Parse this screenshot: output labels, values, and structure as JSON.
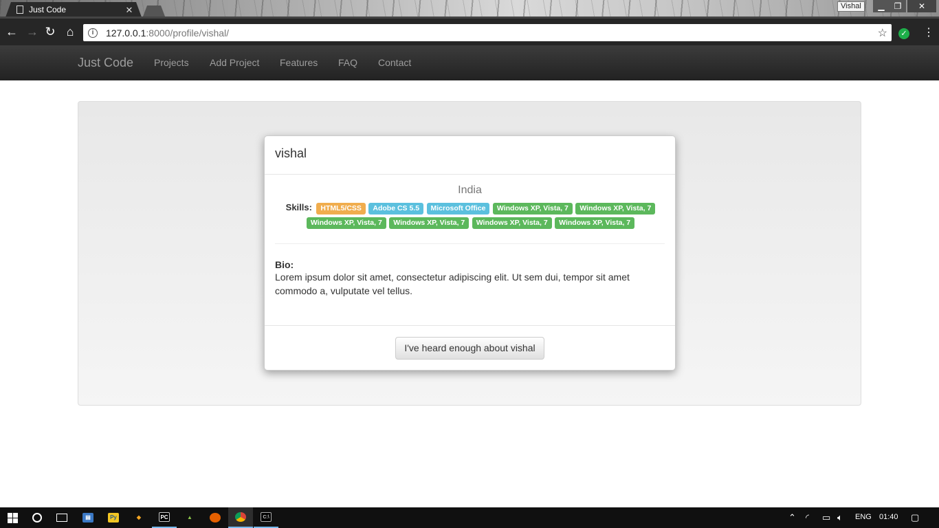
{
  "browser": {
    "tab_title": "Just Code",
    "profile_name": "Vishal",
    "url_host": "127.0.0.1",
    "url_path": ":8000/profile/vishal/"
  },
  "navbar": {
    "brand": "Just Code",
    "links": [
      "Projects",
      "Add Project",
      "Features",
      "FAQ",
      "Contact"
    ]
  },
  "profile": {
    "name": "vishal",
    "country": "India",
    "skills_label": "Skills:",
    "skills": [
      {
        "text": "HTML5/CSS",
        "style": "warning"
      },
      {
        "text": "Adobe CS 5.5",
        "style": "info"
      },
      {
        "text": "Microsoft Office",
        "style": "info"
      },
      {
        "text": "Windows XP, Vista, 7",
        "style": "success"
      },
      {
        "text": "Windows XP, Vista, 7",
        "style": "success"
      },
      {
        "text": "Windows XP, Vista, 7",
        "style": "success"
      },
      {
        "text": "Windows XP, Vista, 7",
        "style": "success"
      },
      {
        "text": "Windows XP, Vista, 7",
        "style": "success"
      },
      {
        "text": "Windows XP, Vista, 7",
        "style": "success"
      }
    ],
    "bio_label": "Bio:",
    "bio": "Lorem ipsum dolor sit amet, consectetur adipiscing elit. Ut sem dui, tempor sit amet commodo a, vulputate vel tellus.",
    "button": "I've heard enough about vishal"
  },
  "taskbar": {
    "language": "ENG",
    "time": "01:40",
    "apps": [
      "pycharm",
      "android-studio",
      "firefox",
      "chrome",
      "command-prompt"
    ]
  },
  "colors": {
    "warning": "#f0ad4e",
    "info": "#5bc0de",
    "success": "#5cb85c",
    "navbar": "#222222"
  }
}
